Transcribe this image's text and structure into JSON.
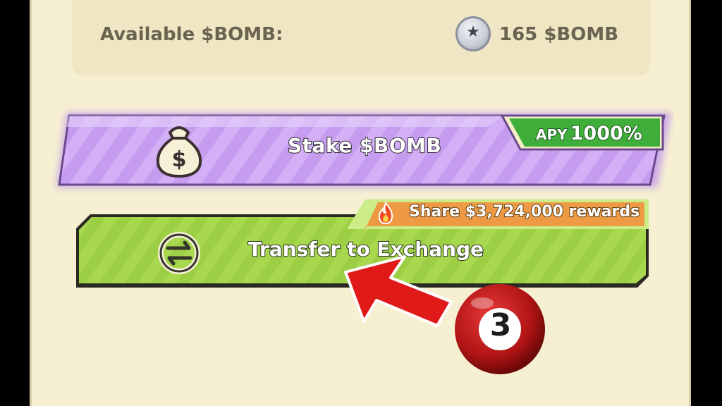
{
  "balance": {
    "label": "Available $BOMB:",
    "amount": "165 $BOMB",
    "coin_icon": "bomb-coin-icon"
  },
  "stake": {
    "label": "Stake $BOMB",
    "apy_prefix": "APY",
    "apy_value": "1000%",
    "icon": "money-bag-icon",
    "color": "#c9a2f2",
    "tag_color": "#3fae3a"
  },
  "rewards": {
    "text": "Share $3,724,000 rewards",
    "icon": "flame-icon",
    "color": "#ee9a45"
  },
  "transfer": {
    "label": "Transfer to Exchange",
    "icon": "swap-arrows-icon",
    "color": "#a6d64b"
  },
  "annotation": {
    "step_number": "3",
    "arrow_color": "#e01919"
  }
}
